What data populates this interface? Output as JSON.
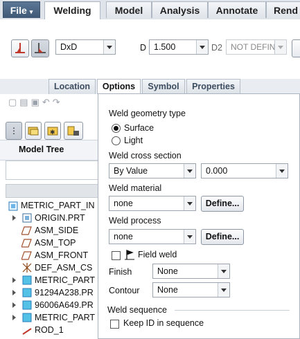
{
  "menu": {
    "file": "File",
    "tabs": [
      "Welding",
      "Model",
      "Analysis",
      "Annotate",
      "Rend"
    ]
  },
  "ribbon": {
    "profile_value": "DxD",
    "d_label": "D",
    "d_value": "1.500",
    "d2_label": "D2",
    "d2_value": "NOT DEFIN"
  },
  "subtabs": [
    "Location",
    "Options",
    "Symbol",
    "Properties"
  ],
  "model_tree": {
    "title": "Model Tree",
    "items": [
      "METRIC_PART_IN",
      "ORIGIN.PRT",
      "ASM_SIDE",
      "ASM_TOP",
      "ASM_FRONT",
      "DEF_ASM_CS",
      "METRIC_PART",
      "91294A238.PR",
      "96006A649.PR",
      "METRIC_PART",
      "ROD_1"
    ]
  },
  "options": {
    "geometry_type_label": "Weld geometry type",
    "surface_label": "Surface",
    "light_label": "Light",
    "cross_section_label": "Weld cross section",
    "cross_section_value": "By Value",
    "cross_section_number": "0.000",
    "material_label": "Weld material",
    "material_value": "none",
    "define_label": "Define...",
    "process_label": "Weld process",
    "process_value": "none",
    "field_weld_label": "Field weld",
    "finish_label": "Finish",
    "finish_value": "None",
    "contour_label": "Contour",
    "contour_value": "None",
    "sequence_label": "Weld sequence",
    "keep_id_label": "Keep ID in sequence"
  }
}
